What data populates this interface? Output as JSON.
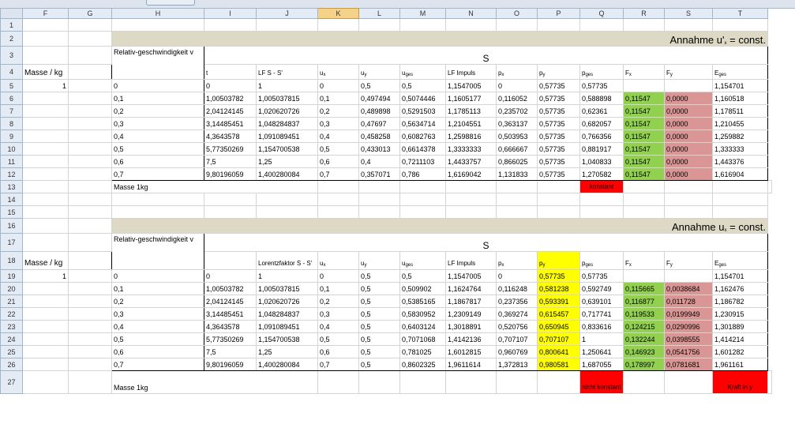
{
  "columns": [
    "F",
    "G",
    "H",
    "I",
    "J",
    "K",
    "L",
    "M",
    "N",
    "O",
    "P",
    "Q",
    "R",
    "S",
    "T"
  ],
  "selected_column": "K",
  "rows_labels": [
    "1",
    "2",
    "3",
    "4",
    "5",
    "6",
    "7",
    "8",
    "9",
    "10",
    "11",
    "12",
    "13",
    "14",
    "15",
    "16",
    "17",
    "18",
    "19",
    "20",
    "21",
    "22",
    "23",
    "24",
    "25",
    "26",
    "27"
  ],
  "table1": {
    "banner_text": "Annahme u'",
    "banner_sub": "x",
    "banner_rest": " = const.",
    "s_label": "S",
    "rel_label": "Relativ-geschwindigkeit v",
    "masse_label": "Masse / kg",
    "masse_value": "1",
    "headers": {
      "t": "t",
      "lf": "LF S - S'",
      "ux": "u",
      "uy": "u",
      "uges": "u",
      "lfimp": "LF Impuls",
      "px": "p",
      "py": "p",
      "pges": "p",
      "fx": "F",
      "fy": "F",
      "eges": "E"
    },
    "header_subs": {
      "ux": "x",
      "uy": "y",
      "uges": "ges",
      "px": "x",
      "py": "y",
      "pges": "ges",
      "fx": "x",
      "fy": "y",
      "eges": "ges"
    },
    "rows": [
      [
        "0",
        "0",
        "1",
        "0",
        "0,5",
        "0,5",
        "1,1547005",
        "0",
        "0,57735",
        "0,57735",
        "",
        "",
        "1,154701"
      ],
      [
        "0,1",
        "1,00503782",
        "1,005037815",
        "0,1",
        "0,497494",
        "0,5074446",
        "1,1605177",
        "0,116052",
        "0,57735",
        "0,588898",
        "0,11547",
        "0,0000",
        "1,160518"
      ],
      [
        "0,2",
        "2,04124145",
        "1,020620726",
        "0,2",
        "0,489898",
        "0,5291503",
        "1,1785113",
        "0,235702",
        "0,57735",
        "0,62361",
        "0,11547",
        "0,0000",
        "1,178511"
      ],
      [
        "0,3",
        "3,14485451",
        "1,048284837",
        "0,3",
        "0,47697",
        "0,5634714",
        "1,2104551",
        "0,363137",
        "0,57735",
        "0,682057",
        "0,11547",
        "0,0000",
        "1,210455"
      ],
      [
        "0,4",
        "4,3643578",
        "1,091089451",
        "0,4",
        "0,458258",
        "0,6082763",
        "1,2598816",
        "0,503953",
        "0,57735",
        "0,766356",
        "0,11547",
        "0,0000",
        "1,259882"
      ],
      [
        "0,5",
        "5,77350269",
        "1,154700538",
        "0,5",
        "0,433013",
        "0,6614378",
        "1,3333333",
        "0,666667",
        "0,57735",
        "0,881917",
        "0,11547",
        "0,0000",
        "1,333333"
      ],
      [
        "0,6",
        "7,5",
        "1,25",
        "0,6",
        "0,4",
        "0,7211103",
        "1,4433757",
        "0,866025",
        "0,57735",
        "1,040833",
        "0,11547",
        "0,0000",
        "1,443376"
      ],
      [
        "0,7",
        "9,80196059",
        "1,400280084",
        "0,7",
        "0,357071",
        "0,786",
        "1,6169042",
        "1,131833",
        "0,57735",
        "1,270582",
        "0,11547",
        "0,0000",
        "1,616904"
      ]
    ],
    "footer_masse": "Masse 1kg",
    "note": "konstant"
  },
  "table2": {
    "banner_text": "Annahme u",
    "banner_sub": "x",
    "banner_rest": " = const.",
    "s_label": "S",
    "rel_label": "Relativ-geschwindigkeit v",
    "masse_label": "Masse / kg",
    "masse_value": "1",
    "headers": {
      "t": "",
      "lf": "Lorentzfaktor S - S'",
      "ux": "u",
      "uy": "u",
      "uges": "u",
      "lfimp": "LF Impuls",
      "px": "p",
      "py": "p",
      "pges": "p",
      "fx": "F",
      "fy": "F",
      "eges": "E"
    },
    "header_subs": {
      "ux": "x",
      "uy": "y",
      "uges": "ges",
      "px": "x",
      "py": "y",
      "pges": "ges",
      "fx": "x",
      "fy": "y",
      "eges": "ges"
    },
    "rows": [
      [
        "0",
        "0",
        "1",
        "0",
        "0,5",
        "0,5",
        "1,1547005",
        "0",
        "0,57735",
        "0,57735",
        "",
        "",
        "1,154701"
      ],
      [
        "0,1",
        "1,00503782",
        "1,005037815",
        "0,1",
        "0,5",
        "0,509902",
        "1,1624764",
        "0,116248",
        "0,581238",
        "0,592749",
        "0,115665",
        "0,0038684",
        "1,162476"
      ],
      [
        "0,2",
        "2,04124145",
        "1,020620726",
        "0,2",
        "0,5",
        "0,5385165",
        "1,1867817",
        "0,237356",
        "0,593391",
        "0,639101",
        "0,116877",
        "0,011728",
        "1,186782"
      ],
      [
        "0,3",
        "3,14485451",
        "1,048284837",
        "0,3",
        "0,5",
        "0,5830952",
        "1,2309149",
        "0,369274",
        "0,615457",
        "0,717741",
        "0,119533",
        "0,0199949",
        "1,230915"
      ],
      [
        "0,4",
        "4,3643578",
        "1,091089451",
        "0,4",
        "0,5",
        "0,6403124",
        "1,3018891",
        "0,520756",
        "0,650945",
        "0,833616",
        "0,124215",
        "0,0290996",
        "1,301889"
      ],
      [
        "0,5",
        "5,77350269",
        "1,154700538",
        "0,5",
        "0,5",
        "0,7071068",
        "1,4142136",
        "0,707107",
        "0,707107",
        "1",
        "0,132244",
        "0,0398555",
        "1,414214"
      ],
      [
        "0,6",
        "7,5",
        "1,25",
        "0,6",
        "0,5",
        "0,781025",
        "1,6012815",
        "0,960769",
        "0,800641",
        "1,250641",
        "0,146923",
        "0,0541756",
        "1,601282"
      ],
      [
        "0,7",
        "9,80196059",
        "1,400280084",
        "0,7",
        "0,5",
        "0,8602325",
        "1,9611614",
        "1,372813",
        "0,980581",
        "1,687055",
        "0,178997",
        "0,0781681",
        "1,961161"
      ]
    ],
    "footer_masse": "Masse 1kg",
    "note1": "nicht konstant",
    "note2": "Kraft in y"
  },
  "colors": {
    "banner": "#ddd9c4",
    "green": "#92d050",
    "pink": "#da9694",
    "yellow": "#ffff00",
    "red": "#ff0000"
  }
}
